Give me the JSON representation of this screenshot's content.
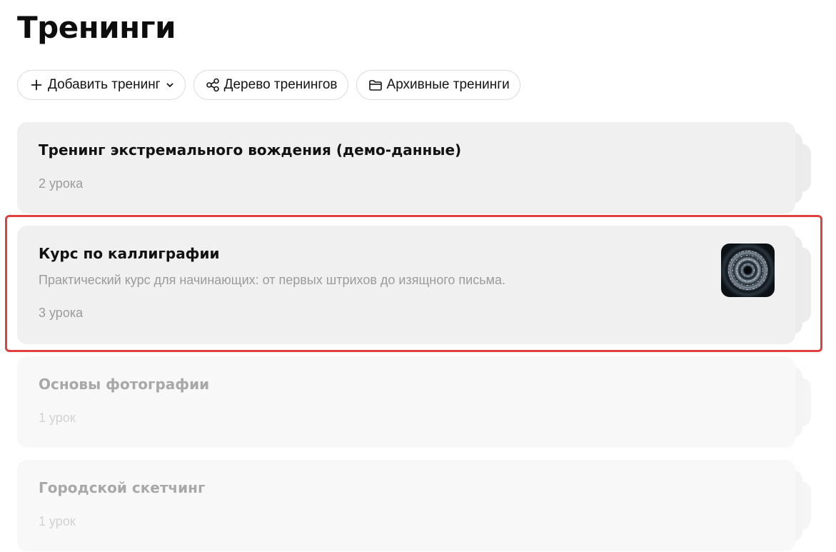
{
  "header": {
    "title": "Тренинги"
  },
  "toolbar": {
    "add_label": "Добавить тренинг",
    "tree_label": "Дерево тренингов",
    "archive_label": "Архивные тренинги"
  },
  "trainings": [
    {
      "title": "Тренинг экстремального вождения (демо-данные)",
      "description": "",
      "lessons": "2 урока"
    },
    {
      "title": "Курс по каллиграфии",
      "description": "Практический курс для начинающих: от первых штрихов до изящного письма.",
      "lessons": "3 урока"
    },
    {
      "title": "Основы фотографии",
      "description": "",
      "lessons": "1 урок"
    },
    {
      "title": "Городской скетчинг",
      "description": "",
      "lessons": "1 урок"
    }
  ],
  "colors": {
    "highlight": "#e04040",
    "card_bg": "#f0f0f0"
  }
}
